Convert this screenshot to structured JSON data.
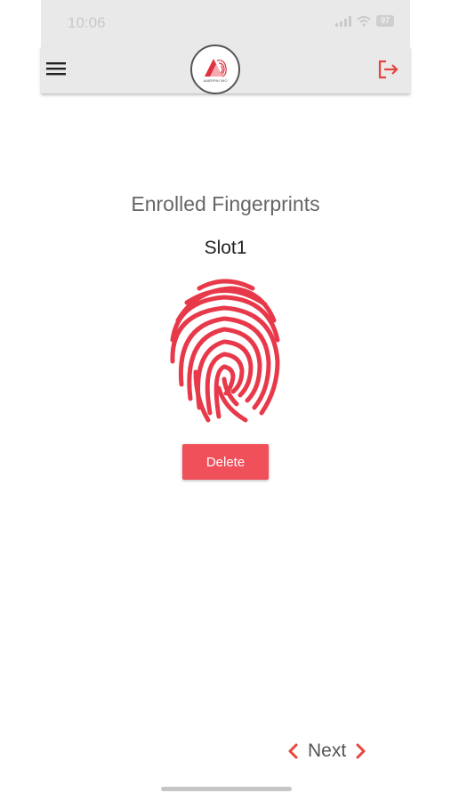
{
  "status_bar": {
    "time": "10:06",
    "battery": "97"
  },
  "header": {
    "menu_icon": "hamburger-menu-icon",
    "logo_text": "AMERPAY BIO",
    "logout_icon": "logout-icon"
  },
  "main": {
    "title": "Enrolled Fingerprints",
    "slot_label": "Slot1",
    "fingerprint_icon": "fingerprint-icon",
    "delete_label": "Delete"
  },
  "footer": {
    "next_label": "Next"
  },
  "colors": {
    "accent": "#f0505a",
    "header_bg": "#e9e9e9",
    "text_muted": "#666666"
  }
}
